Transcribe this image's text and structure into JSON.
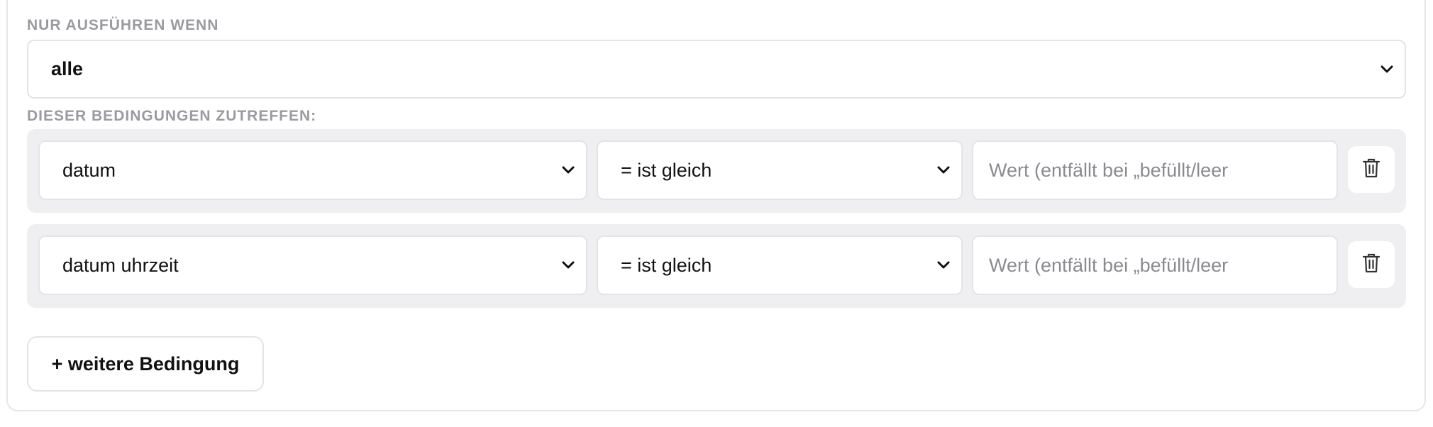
{
  "condition_builder": {
    "run_only_if_label": "NUR AUSFÜHREN WENN",
    "match_mode": {
      "selected": "alle"
    },
    "conditions_label": "DIESER BEDINGUNGEN ZUTREFFEN:",
    "conditions": [
      {
        "field": "datum",
        "operator": "= ist gleich",
        "value": "",
        "value_placeholder": "Wert (entfällt bei „befüllt/leer"
      },
      {
        "field": "datum uhrzeit",
        "operator": "= ist gleich",
        "value": "",
        "value_placeholder": "Wert (entfällt bei „befüllt/leer"
      }
    ],
    "add_condition_label": "+ weitere Bedingung"
  },
  "icons": {
    "chevron": "chevron-down-icon",
    "delete": "trash-icon"
  },
  "colors": {
    "panel_border": "#e5e6e9",
    "row_background": "#efeff1",
    "label_gray": "#9a9ba1",
    "placeholder_gray": "#8a8b90",
    "text": "#111111"
  }
}
